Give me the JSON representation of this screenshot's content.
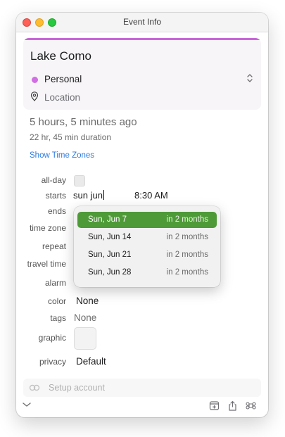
{
  "window": {
    "title": "Event Info"
  },
  "event": {
    "title": "Lake Como",
    "calendar": "Personal",
    "calendar_color": "#d16ee3",
    "accent_color": "#c965d9",
    "location_placeholder": "Location"
  },
  "summary": {
    "time_ago": "5 hours, 5 minutes ago",
    "duration": "22 hr, 45 min duration",
    "time_zones_link": "Show Time Zones"
  },
  "fields": {
    "all_day_label": "all-day",
    "starts_label": "starts",
    "starts_date_input": "sun jun",
    "starts_time": "8:30 AM",
    "ends_label": "ends",
    "time_zone_label": "time zone",
    "repeat_label": "repeat",
    "travel_time_label": "travel time",
    "alarm_label": "alarm",
    "color_label": "color",
    "color_value": "None",
    "tags_label": "tags",
    "tags_value": "None",
    "graphic_label": "graphic",
    "privacy_label": "privacy",
    "privacy_value": "Default"
  },
  "date_suggestions": [
    {
      "date": "Sun, Jun 7",
      "relative": "in 2 months",
      "selected": true
    },
    {
      "date": "Sun, Jun 14",
      "relative": "in 2 months",
      "selected": false
    },
    {
      "date": "Sun, Jun 21",
      "relative": "in 2 months",
      "selected": false
    },
    {
      "date": "Sun, Jun 28",
      "relative": "in 2 months",
      "selected": false
    }
  ],
  "selection_color": "#4e9a38",
  "footer": {
    "setup_text": "Setup account",
    "icons": [
      "chevron-down-icon",
      "add-to-calendar-icon",
      "share-icon",
      "command-icon"
    ]
  }
}
